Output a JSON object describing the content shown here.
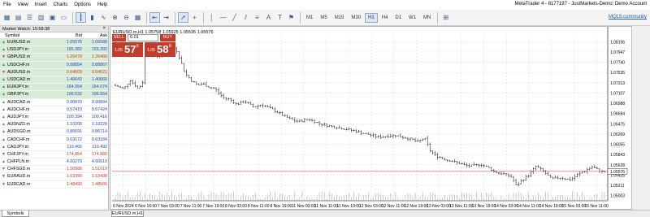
{
  "menu": [
    "File",
    "View",
    "Insert",
    "Charts",
    "Options",
    "Help"
  ],
  "window_title": "MetaTrader 4 - 8177197 - JustMarkets-Demo: Demo Account",
  "toolbar": {
    "timeframes": [
      "M1",
      "M5",
      "M15",
      "M30",
      "H1",
      "H4",
      "D1",
      "W1",
      "MN"
    ],
    "active_timeframe": "H1",
    "link": "MQL5.community"
  },
  "market_watch": {
    "title": "Market Watch: 15:58:38",
    "close": "×",
    "headers": {
      "symbol": "Symbol",
      "bid": "Bid",
      "ask": "Ask"
    },
    "rows": [
      {
        "symbol": "EURUSD.m",
        "bid": "1.05576",
        "ask": "1.05588",
        "dir": "up",
        "hl": true
      },
      {
        "symbol": "USDJPY.m",
        "bid": "155.382",
        "ask": "155.392",
        "dir": "up",
        "hl": true
      },
      {
        "symbol": "GBPUSD.m",
        "bid": "1.26479",
        "ask": "1.26489",
        "dir": "down",
        "hl": true
      },
      {
        "symbol": "USDCHF.m",
        "bid": "0.88854",
        "ask": "0.88867",
        "dir": "up",
        "hl": true
      },
      {
        "symbol": "AUDUSD.m",
        "bid": "0.64609",
        "ask": "0.64621",
        "dir": "down",
        "hl": true
      },
      {
        "symbol": "USDCAD.m",
        "bid": "1.40643",
        "ask": "1.40660",
        "dir": "up",
        "hl": true
      },
      {
        "symbol": "EURJPY.m",
        "bid": "164.054",
        "ask": "164.074",
        "dir": "up",
        "hl": true
      },
      {
        "symbol": "GBPJPY.m",
        "bid": "196.532",
        "ask": "196.554",
        "dir": "up",
        "hl": true
      },
      {
        "symbol": "AUDCAD.m",
        "bid": "0.90870",
        "ask": "0.90894",
        "dir": "up",
        "hl": false
      },
      {
        "symbol": "AUDCHF.m",
        "bid": "0.57410",
        "ask": "0.57424",
        "dir": "up",
        "hl": false
      },
      {
        "symbol": "AUDJPY.m",
        "bid": "100.394",
        "ask": "100.416",
        "dir": "up",
        "hl": false
      },
      {
        "symbol": "AUDNZD.m",
        "bid": "1.10208",
        "ask": "1.10228",
        "dir": "up",
        "hl": false
      },
      {
        "symbol": "AUDSGD.m",
        "bid": "0.86691",
        "ask": "0.86714",
        "dir": "up",
        "hl": false
      },
      {
        "symbol": "CADCHF.m",
        "bid": "0.63172",
        "ask": "0.63184",
        "dir": "up",
        "hl": false
      },
      {
        "symbol": "CADJPY.m",
        "bid": "110.465",
        "ask": "110.492",
        "dir": "up",
        "hl": false
      },
      {
        "symbol": "CHFJPY.m",
        "bid": "174.854",
        "ask": "174.880",
        "dir": "down",
        "hl": false
      },
      {
        "symbol": "CHFPLN.m",
        "bid": "4.60279",
        "ask": "4.60510",
        "dir": "up",
        "hl": false
      },
      {
        "symbol": "CHFSGD.m",
        "bid": "1.50988",
        "ask": "1.51019",
        "dir": "down",
        "hl": false
      },
      {
        "symbol": "EURAUD.m",
        "bid": "1.63390",
        "ask": "1.63408",
        "dir": "down",
        "hl": false
      },
      {
        "symbol": "EURCAD.m",
        "bid": "1.48490",
        "ask": "1.48506",
        "dir": "down",
        "hl": false
      }
    ]
  },
  "market_watch_tab": "Symbols",
  "chart_tab": "EURUSD.m,H1",
  "one_click": {
    "sell_label": "SELL",
    "buy_label": "BUY",
    "lot": "0.01",
    "sell_small": "1.05",
    "sell_big": "57",
    "sell_sup": "6",
    "buy_small": "1.05",
    "buy_big": "58",
    "buy_sup": "8"
  },
  "chart_data": {
    "type": "candlestick",
    "header": "EURUSD.m,H1  1.05758 1.05925 1.05535 1.05576",
    "y_ticks": [
      "1.08156",
      "1.07947",
      "1.07740",
      "1.07535",
      "1.07313",
      "1.07107",
      "1.06988",
      "1.06684",
      "1.06475",
      "1.06269",
      "1.06055",
      "1.05843",
      "1.05628",
      "1.05425",
      "1.05211",
      "1.05003"
    ],
    "ylim": [
      1.0497,
      1.0835
    ],
    "current_price": "1.05576",
    "current_value": 1.05576,
    "x_ticks": [
      "6 Nov 2024",
      "6 Nov 16:00",
      "7 Nov 03:00",
      "7 Nov 11:00",
      "7 Nov 19:00",
      "8 Nov 03:00",
      "8 Nov 11:00",
      "8 Nov 19:00",
      "11 Nov 03:00",
      "11 Nov 11:00",
      "11 Nov 19:00",
      "12 Nov 03:00",
      "12 Nov 11:00",
      "12 Nov 19:00",
      "13 Nov 03:00",
      "13 Nov 11:00",
      "13 Nov 19:00",
      "14 Nov 03:00",
      "14 Nov 11:00",
      "14 Nov 19:00",
      "15 Nov 03:00",
      "15 Nov 11:00"
    ],
    "path": [
      [
        0,
        1.0735
      ],
      [
        14,
        1.0728
      ],
      [
        22,
        1.0745
      ],
      [
        32,
        1.0728
      ],
      [
        36,
        1.0736
      ],
      [
        38,
        1.0742
      ],
      [
        41,
        1.0805
      ],
      [
        48,
        1.0808
      ],
      [
        56,
        1.0795
      ],
      [
        68,
        1.08
      ],
      [
        80,
        1.0812
      ],
      [
        86,
        1.0788
      ],
      [
        92,
        1.076
      ],
      [
        100,
        1.0745
      ],
      [
        108,
        1.0735
      ],
      [
        115,
        1.0738
      ],
      [
        122,
        1.0731
      ],
      [
        130,
        1.0728
      ],
      [
        140,
        1.071
      ],
      [
        150,
        1.0705
      ],
      [
        158,
        1.0695
      ],
      [
        168,
        1.0702
      ],
      [
        180,
        1.069
      ],
      [
        190,
        1.0695
      ],
      [
        200,
        1.0688
      ],
      [
        210,
        1.068
      ],
      [
        220,
        1.067
      ],
      [
        235,
        1.066
      ],
      [
        250,
        1.0665
      ],
      [
        265,
        1.0655
      ],
      [
        280,
        1.065
      ],
      [
        300,
        1.0644
      ],
      [
        320,
        1.0636
      ],
      [
        340,
        1.0628
      ],
      [
        360,
        1.0632
      ],
      [
        380,
        1.0624
      ],
      [
        390,
        1.0618
      ],
      [
        398,
        1.0627
      ],
      [
        405,
        1.06
      ],
      [
        412,
        1.059
      ],
      [
        425,
        1.0582
      ],
      [
        440,
        1.0575
      ],
      [
        455,
        1.0568
      ],
      [
        470,
        1.0572
      ],
      [
        480,
        1.0565
      ],
      [
        490,
        1.0555
      ],
      [
        500,
        1.0552
      ],
      [
        510,
        1.0545
      ],
      [
        515,
        1.0528
      ],
      [
        522,
        1.0538
      ],
      [
        532,
        1.0552
      ],
      [
        540,
        1.0568
      ],
      [
        548,
        1.056
      ],
      [
        555,
        1.055
      ],
      [
        560,
        1.0542
      ],
      [
        570,
        1.0545
      ],
      [
        585,
        1.054
      ],
      [
        595,
        1.0552
      ],
      [
        605,
        1.056
      ],
      [
        612,
        1.0567
      ],
      [
        620,
        1.056
      ],
      [
        628,
        1.0556
      ]
    ]
  }
}
